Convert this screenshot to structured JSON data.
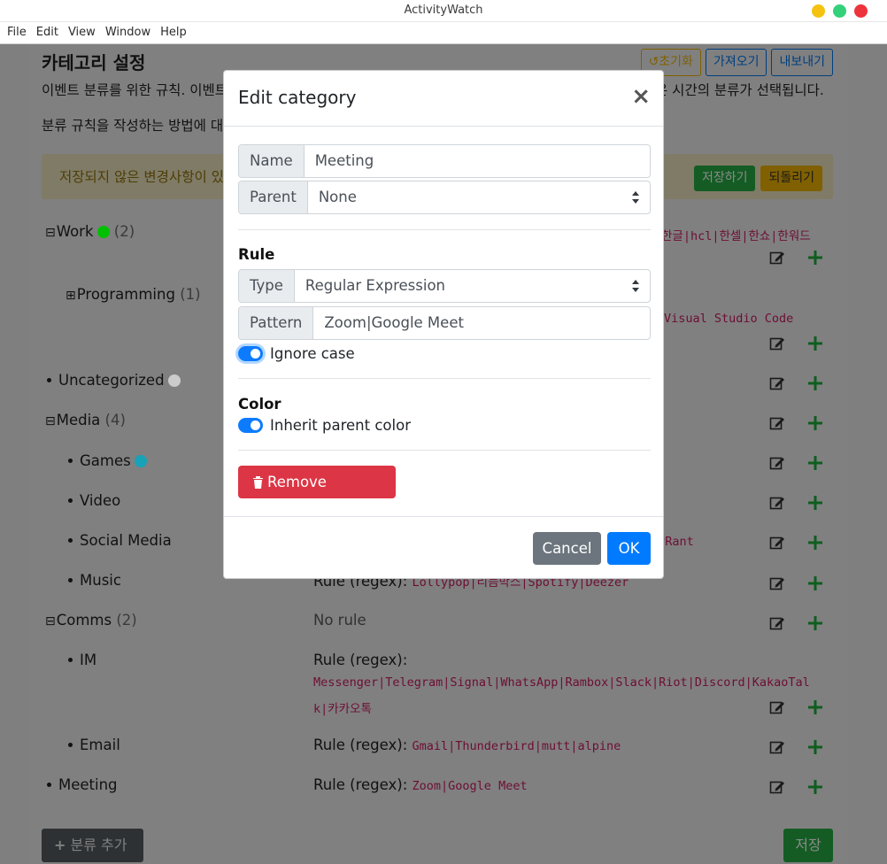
{
  "window": {
    "title": "ActivityWatch",
    "buttons": {
      "minimize_color": "#f5c211",
      "maximize_color": "#33d17a",
      "close_color": "#ed333b"
    }
  },
  "menubar": [
    "File",
    "Edit",
    "View",
    "Window",
    "Help"
  ],
  "page": {
    "heading": "카테고리 설정",
    "description_start": "이벤트 분류를 위한 규칙. 이벤트",
    "description_end": "은 시간의 분류가 선택됩니다.",
    "description2": "분류 규칙을 작성하는 방법에 대",
    "buttons": {
      "reset": "초기화",
      "import": "가져오기",
      "export": "내보내기"
    },
    "alert": {
      "text": "저장되지 않은 변경사항이 있",
      "save": "저장하기",
      "revert": "되돌리기"
    },
    "add_category": "분류 추가",
    "save": "저장"
  },
  "categories": [
    {
      "name": "Work",
      "count": "(2)",
      "color": "#00c000",
      "expanded": true,
      "rule_fragment": "한글|hcl|한셀|한쇼|한워드"
    },
    {
      "name": "Programming",
      "count": "(1)",
      "expanded": false,
      "rule_fragment": "Visual Studio Code"
    },
    {
      "name": "Uncategorized",
      "color": "#cccccc"
    },
    {
      "name": "Media",
      "count": "(4)",
      "expanded": true
    },
    {
      "name": "Games",
      "color": "#17a2b8"
    },
    {
      "name": "Video"
    },
    {
      "name": "Social Media",
      "rule_fragment": "evRant"
    },
    {
      "name": "Music",
      "rule_label": "Rule (regex):",
      "rule_pattern": "Lollypop|리듬박스|Spotify|Deezer"
    },
    {
      "name": "Comms",
      "count": "(2)",
      "expanded": true,
      "rule_label": "No rule"
    },
    {
      "name": "IM",
      "rule_label": "Rule (regex):",
      "rule_pattern_line1": "Messenger|Telegram|Signal|WhatsApp|Rambox|Slack|Riot|Discord|KakaoTal",
      "rule_pattern_line2": "k|카카오톡"
    },
    {
      "name": "Email",
      "rule_label": "Rule (regex):",
      "rule_pattern": "Gmail|Thunderbird|mutt|alpine"
    },
    {
      "name": "Meeting",
      "rule_label": "Rule (regex):",
      "rule_pattern": "Zoom|Google Meet"
    }
  ],
  "modal": {
    "title": "Edit category",
    "close": "×",
    "name_label": "Name",
    "name_value": "Meeting",
    "parent_label": "Parent",
    "parent_value": "None",
    "rule_heading": "Rule",
    "type_label": "Type",
    "type_value": "Regular Expression",
    "pattern_label": "Pattern",
    "pattern_value": "Zoom|Google Meet",
    "ignore_case_label": "Ignore case",
    "ignore_case": true,
    "color_heading": "Color",
    "inherit_label": "Inherit parent color",
    "inherit_color": true,
    "remove_label": "Remove category",
    "cancel_label": "Cancel",
    "ok_label": "OK"
  }
}
